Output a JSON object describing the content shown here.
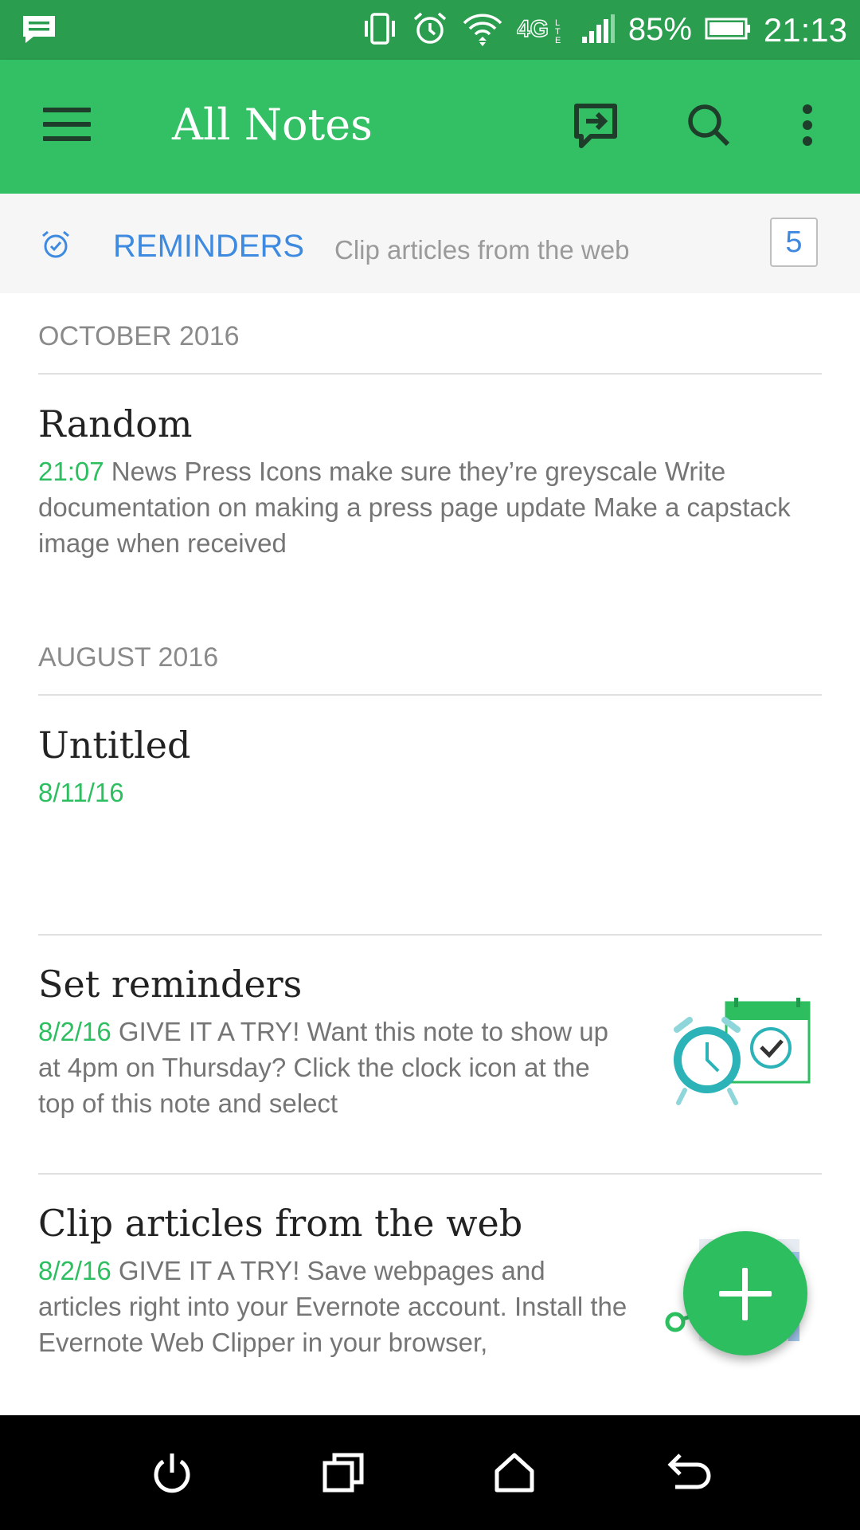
{
  "status_bar": {
    "battery": "85%",
    "time": "21:13",
    "network": "4G",
    "icons": [
      "message-icon",
      "vibrate-icon",
      "alarm-icon",
      "wifi-icon",
      "4g-lte-icon",
      "signal-icon",
      "battery-icon"
    ]
  },
  "app_bar": {
    "title": "All Notes",
    "icons": [
      "menu-icon",
      "sync-icon",
      "search-icon",
      "more-icon"
    ]
  },
  "reminders": {
    "label": "REMINDERS",
    "preview": "Clip articles from the web",
    "count": "5"
  },
  "sections": [
    {
      "header": "OCTOBER 2016",
      "notes": [
        {
          "title": "Random",
          "date": "21:07",
          "snippet": " News Press  Icons  make sure they’re greyscale Write documentation on making a press page update Make a capstack image when received"
        }
      ]
    },
    {
      "header": "AUGUST 2016",
      "notes": [
        {
          "title": "Untitled",
          "date": "8/11/16",
          "snippet": ""
        },
        {
          "title": "Set reminders",
          "date": "8/2/16",
          "snippet": " GIVE IT A TRY!    Want this note to show up at 4pm on Thursday? Click the clock icon at the top of this note    and select",
          "thumbnail": "reminder-clock-calendar"
        },
        {
          "title": "Clip articles from the web",
          "date": "8/2/16",
          "snippet": " GIVE IT A TRY! Save webpages and articles right into your Evernote account. Install the Evernote Web Clipper in your browser,",
          "thumbnail": "web-clipper"
        }
      ]
    }
  ],
  "fab": {
    "icon": "plus-icon"
  },
  "nav_bar": {
    "icons": [
      "power-icon",
      "recents-icon",
      "home-icon",
      "back-icon"
    ]
  },
  "colors": {
    "status_bar": "#2a9d4e",
    "app_bar": "#33c064",
    "accent_green": "#2dbe60",
    "reminder_blue": "#3d8ae0"
  }
}
